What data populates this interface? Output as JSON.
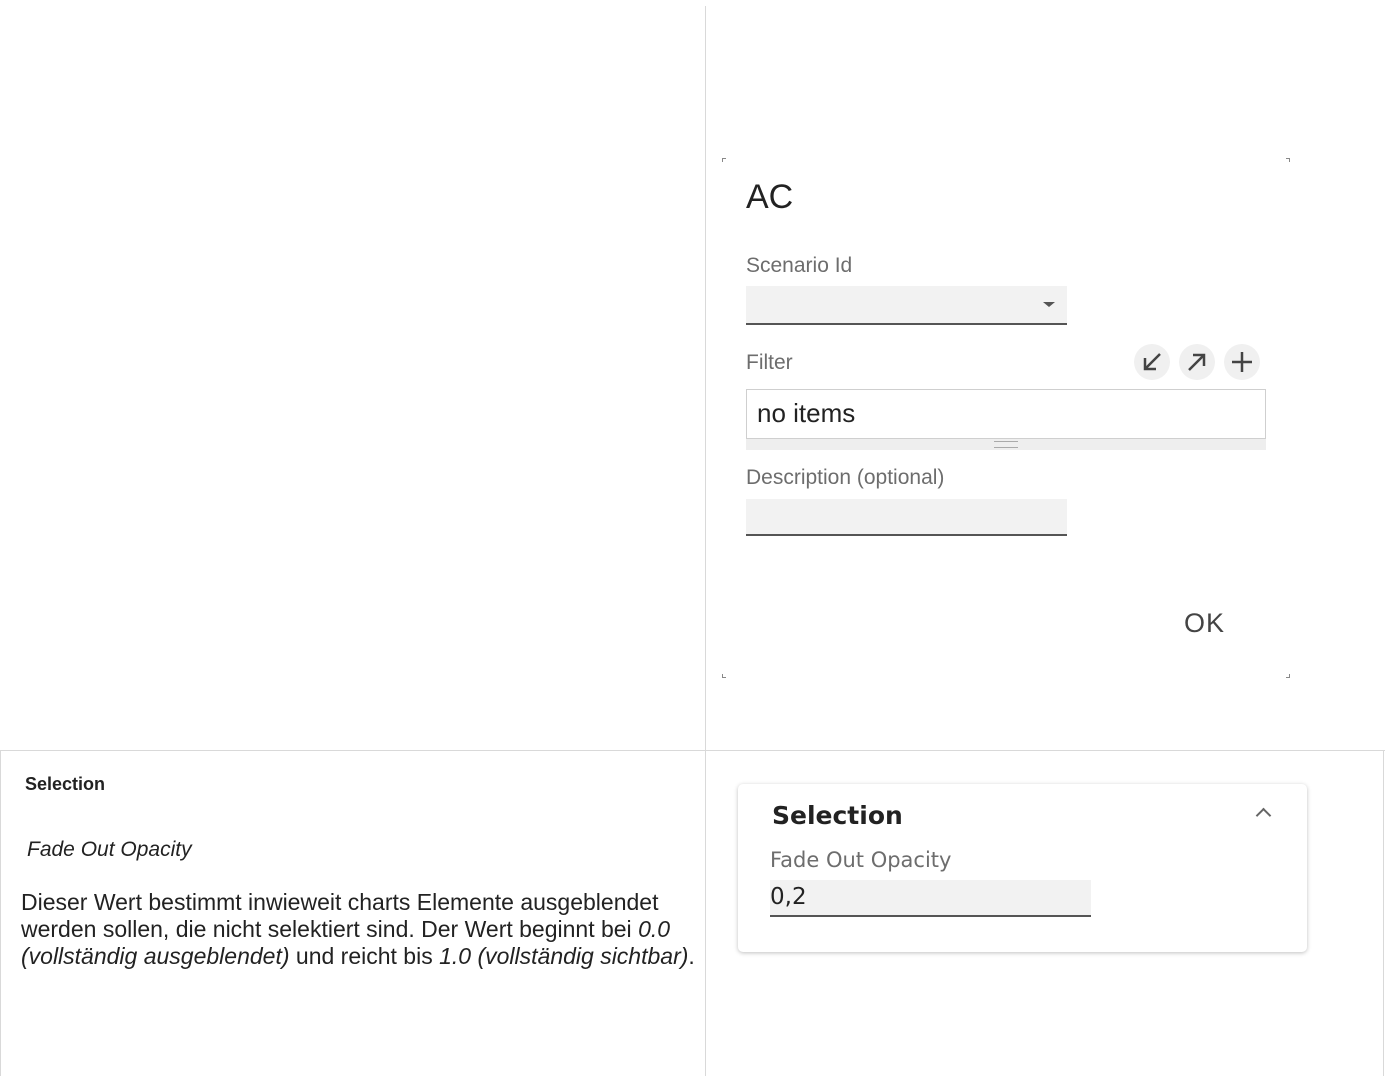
{
  "dialog": {
    "title": "AC",
    "scenario_label": "Scenario Id",
    "scenario_value": "",
    "filter_label": "Filter",
    "filter_text": "no items",
    "description_label": "Description (optional)",
    "description_value": "",
    "ok_label": "OK",
    "icons": {
      "collapse": "arrow-down-left-icon",
      "expand": "arrow-up-right-icon",
      "add": "plus-icon"
    }
  },
  "doc": {
    "heading": "Selection",
    "subheading": "Fade Out Opacity",
    "desc_part1": "Dieser Wert bestimmt inwieweit charts Elemente ausgeblendet werden sollen, die nicht selektiert sind. Der Wert beginnt bei ",
    "desc_em1": "0.0 (vollständig ausgeblendet)",
    "desc_part2": " und reicht bis ",
    "desc_em2": "1.0 (vollständig sichtbar)",
    "desc_part3": "."
  },
  "card": {
    "title": "Selection",
    "field_label": "Fade Out Opacity",
    "field_value": "0,2"
  }
}
